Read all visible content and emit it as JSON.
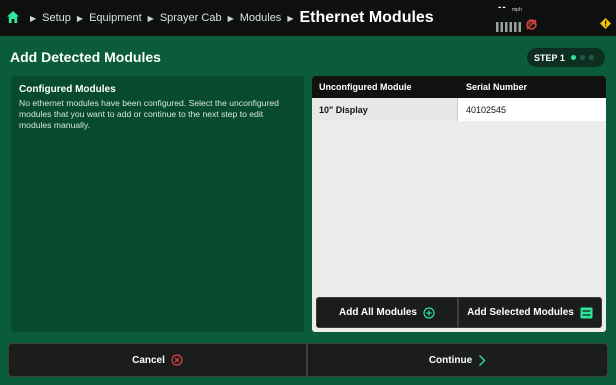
{
  "colors": {
    "topbar": "#0e0f0f",
    "background": "#0b5c3b",
    "panel": "#084a2f",
    "accent": "#2ee59a",
    "cancel_icon": "#e0443f",
    "alert": "#f5c400"
  },
  "breadcrumb": {
    "home_icon": "home-icon",
    "items": [
      "Setup",
      "Equipment",
      "Sprayer Cab",
      "Modules"
    ],
    "current": "Ethernet Modules"
  },
  "status": {
    "speed_value": "--",
    "speed_unit": "mph",
    "icons": [
      "signal-bars-icon",
      "gps-off-icon",
      "alert-icon"
    ]
  },
  "page": {
    "title": "Add Detected Modules",
    "step_label": "STEP 1",
    "step_count": 3,
    "step_active": 1
  },
  "configured": {
    "title": "Configured Modules",
    "text": "No ethernet modules have been configured. Select the unconfigured modules that you want to add or continue to the next step to edit modules manually."
  },
  "table": {
    "columns": [
      "Unconfigured Module",
      "Serial Number"
    ],
    "rows": [
      {
        "module": "10\" Display",
        "serial": "40102545"
      }
    ],
    "add_all_label": "Add All Modules",
    "add_selected_label": "Add Selected Modules"
  },
  "footer": {
    "cancel_label": "Cancel",
    "continue_label": "Continue"
  }
}
